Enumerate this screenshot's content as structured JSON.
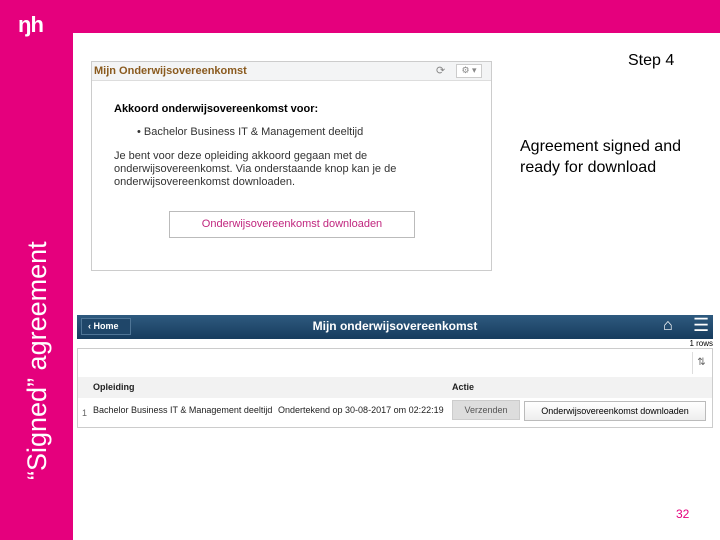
{
  "slide": {
    "logo": "ŋh",
    "vertical_title": "“Signed” agreement",
    "step": "Step 4",
    "description": "Agreement signed and ready for download",
    "page_number": "32",
    "brand_color": "#e5007d"
  },
  "panel": {
    "title": "Mijn Onderwijsovereenkomst",
    "heading": "Akkoord onderwijsovereenkomst voor:",
    "program": "Bachelor Business IT & Management deeltijd",
    "paragraph": "Je bent voor deze opleiding akkoord gegaan met de onderwijsovereenkomst. Via onderstaande knop kan je de onderwijsovereenkomst downloaden.",
    "download_label": "Onderwijsovereenkomst downloaden",
    "refresh_icon": "⟳",
    "gear_icon": "⚙ ▾"
  },
  "app": {
    "home_label": "‹ Home",
    "title": "Mijn onderwijsovereenkomst",
    "home_icon": "⌂",
    "menu_icon": "☰",
    "rows_count": "1 rows",
    "sort_icon": "⇅",
    "columns": [
      "Opleiding",
      "Actie"
    ],
    "row": {
      "num": "1",
      "program": "Bachelor Business IT & Management deeltijd",
      "status": "Ondertekend op 30-08-2017 om 02:22:19",
      "send_label": "Verzenden",
      "download_label": "Onderwijsovereenkomst downloaden"
    }
  }
}
